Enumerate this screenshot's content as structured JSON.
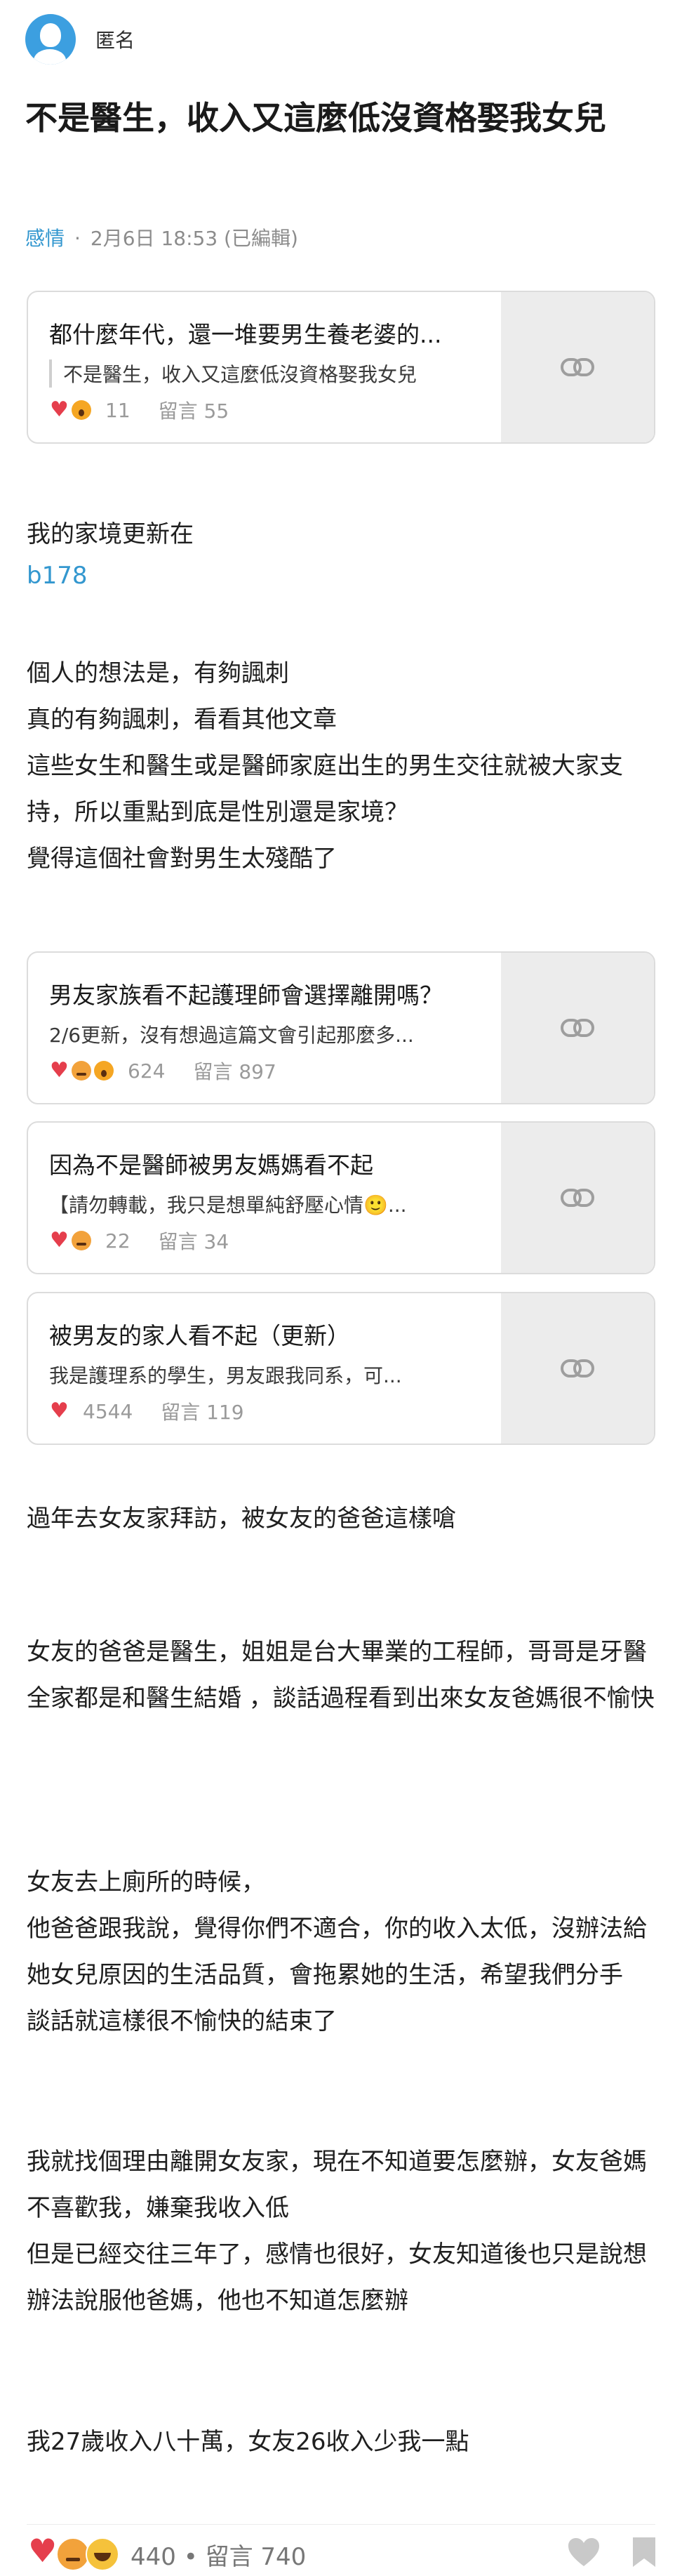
{
  "author": {
    "name": "匿名"
  },
  "post": {
    "title": "不是醫生，收入又這麼低沒資格娶我女兒",
    "category": "感情",
    "separator": "·",
    "date": "2月6日 18:53 (已編輯)"
  },
  "cards": [
    {
      "title": "都什麼年代，還一堆要男生養老婆的...",
      "excerpt": "不是醫生，收入又這麼低沒資格娶我女兒",
      "reactions": [
        "heart",
        "wow"
      ],
      "count": "11",
      "comments": "留言 55"
    },
    {
      "title": "男友家族看不起護理師會選擇離開嗎？",
      "excerpt": "2/6更新，沒有想過這篇文會引起那麼多...",
      "reactions": [
        "heart",
        "angry",
        "wow"
      ],
      "count": "624",
      "comments": "留言 897"
    },
    {
      "title": "因為不是醫師被男友媽媽看不起",
      "excerpt": "【請勿轉載，我只是想單純舒壓心情🙂...",
      "reactions": [
        "heart",
        "angry"
      ],
      "count": "22",
      "comments": "留言 34"
    },
    {
      "title": "被男友的家人看不起（更新）",
      "excerpt": "我是護理系的學生，男友跟我同系，可...",
      "reactions": [
        "heart"
      ],
      "count": "4544",
      "comments": "留言 119"
    }
  ],
  "body": {
    "p1": "我的家境更新在",
    "link": "b178",
    "p2": "個人的想法是，有夠諷刺\n真的有夠諷刺，看看其他文章\n這些女生和醫生或是醫師家庭出生的男生交往就被大家支持，所以重點到底是性別還是家境？\n覺得這個社會對男生太殘酷了",
    "p3": "過年去女友家拜訪，被女友的爸爸這樣嗆",
    "p4": "女友的爸爸是醫生，姐姐是台大畢業的工程師，哥哥是牙醫 全家都是和醫生結婚 ，談話過程看到出來女友爸媽很不愉快",
    "p5": "女友去上廁所的時候，\n他爸爸跟我說，覺得你們不適合，你的收入太低，沒辦法給她女兒原因的生活品質，會拖累她的生活，希望我們分手\n談話就這樣很不愉快的結束了",
    "p6": "我就找個理由離開女友家，現在不知道要怎麼辦，女友爸媽不喜歡我，嫌棄我收入低\n但是已經交往三年了，感情也很好，女友知道後也只是說想辦法說服他爸媽，他也不知道怎麼辦",
    "p7": "我27歲收入八十萬，女友26收入少我一點"
  },
  "footer": {
    "reactions": [
      "heart",
      "angry",
      "laugh"
    ],
    "stats": "440 • 留言 740",
    "icons": [
      "like-heart-icon",
      "bookmark-icon"
    ]
  },
  "colors": {
    "accent": "#3397cf",
    "heart": "#e53e4c",
    "muted": "#8c8c8c"
  }
}
